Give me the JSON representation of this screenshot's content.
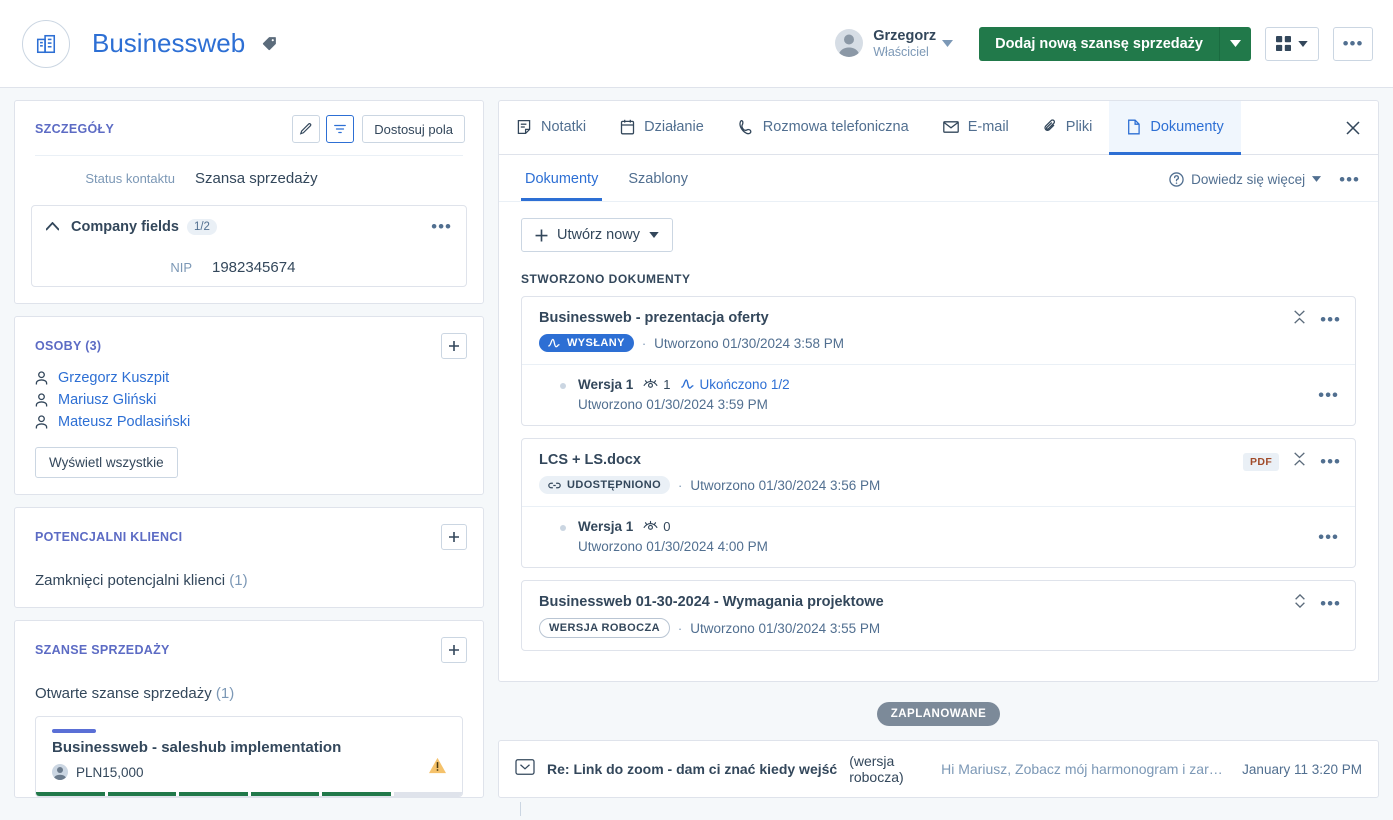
{
  "header": {
    "company_name": "Businessweb",
    "company_icon": "office-building-icon",
    "tag_icon": "tag-icon",
    "owner_name": "Grzegorz",
    "owner_role": "Właściciel",
    "primary_button": "Dodaj nową szansę sprzedaży",
    "grid_icon": "grid-view-icon",
    "more_icon": "ellipsis-icon",
    "accent_green": "#21794a",
    "accent_blue": "#2d6fd4"
  },
  "details": {
    "title": "SZCZEGÓŁY",
    "edit_icon": "pencil-icon",
    "filter_icon": "filter-icon",
    "customize_button": "Dostosuj pola",
    "field_label": "Status kontaktu",
    "field_value": "Szansa sprzedaży",
    "group": {
      "title": "Company fields",
      "count": "1/2",
      "collapse_icon": "chevron-up-icon",
      "more_icon": "ellipsis-icon",
      "fields": [
        {
          "label": "NIP",
          "value": "1982345674"
        }
      ]
    }
  },
  "people": {
    "title": "OSOBY (3)",
    "add_icon": "plus-icon",
    "items": [
      {
        "name": "Grzegorz Kuszpit",
        "icon": "person-icon"
      },
      {
        "name": "Mariusz Gliński",
        "icon": "person-icon"
      },
      {
        "name": "Mateusz Podlasiński",
        "icon": "person-icon"
      }
    ],
    "view_all_button": "Wyświetl wszystkie"
  },
  "leads": {
    "title": "POTENCJALNI KLIENCI",
    "add_icon": "plus-icon",
    "row_text": "Zamknięci potencjalni klienci",
    "row_count": "(1)"
  },
  "deals": {
    "title": "SZANSE SPRZEDAŻY",
    "add_icon": "plus-icon",
    "open_text": "Otwarte szanse sprzedaży",
    "open_count": "(1)",
    "card": {
      "title": "Businessweb - saleshub implementation",
      "amount": "PLN15,000",
      "warning_icon": "warning-triangle-icon",
      "avatar_icon": "person-avatar-icon",
      "stages_total": 6,
      "stages_complete": 5
    }
  },
  "tabs": {
    "items": [
      {
        "label": "Notatki",
        "icon": "note-icon",
        "active": false
      },
      {
        "label": "Działanie",
        "icon": "calendar-icon",
        "active": false
      },
      {
        "label": "Rozmowa telefoniczna",
        "icon": "phone-icon",
        "active": false
      },
      {
        "label": "E-mail",
        "icon": "envelope-icon",
        "active": false
      },
      {
        "label": "Pliki",
        "icon": "paperclip-icon",
        "active": false
      },
      {
        "label": "Dokumenty",
        "icon": "document-icon",
        "active": true
      }
    ],
    "close_icon": "close-icon"
  },
  "documents_panel": {
    "subtabs": [
      {
        "label": "Dokumenty",
        "active": true
      },
      {
        "label": "Szablony",
        "active": false
      }
    ],
    "learn_more": "Dowiedz się więcej",
    "help_icon": "question-circle-icon",
    "chevron_icon": "chevron-down-icon",
    "more_icon": "ellipsis-icon",
    "create_button": "Utwórz nowy",
    "create_icon": "plus-icon",
    "create_chevron": "chevron-down-icon",
    "section_label": "STWORZONO DOKUMENTY",
    "created_prefix": "Utworzono",
    "documents": [
      {
        "title": "Businessweb - prezentacja oferty",
        "status_badge": "WYSŁANY",
        "status_type": "sent",
        "status_icon": "signature-icon",
        "created": "Utworzono 01/30/2024 3:58 PM",
        "file_badge": null,
        "collapse_icon": "collapse-icon",
        "more_icon": "ellipsis-icon",
        "version": {
          "name": "Wersja 1",
          "views_icon": "eye-icon",
          "views": "1",
          "signed_icon": "signature-icon",
          "signed_text": "Ukończono 1/2",
          "created": "Utworzono 01/30/2024 3:59 PM",
          "more_icon": "ellipsis-icon"
        }
      },
      {
        "title": "LCS + LS.docx",
        "status_badge": "UDOSTĘPNIONO",
        "status_type": "shared",
        "status_icon": "link-icon",
        "created": "Utworzono 01/30/2024 3:56 PM",
        "file_badge": "PDF",
        "collapse_icon": "collapse-icon",
        "more_icon": "ellipsis-icon",
        "version": {
          "name": "Wersja 1",
          "views_icon": "eye-icon",
          "views": "0",
          "signed_icon": null,
          "signed_text": null,
          "created": "Utworzono 01/30/2024 4:00 PM",
          "more_icon": "ellipsis-icon"
        }
      },
      {
        "title": "Businessweb 01-30-2024 - Wymagania projektowe",
        "status_badge": "WERSJA ROBOCZA",
        "status_type": "draft",
        "status_icon": null,
        "created": "Utworzono 01/30/2024 3:55 PM",
        "file_badge": null,
        "collapse_icon": "expand-icon",
        "more_icon": "ellipsis-icon",
        "version": null
      }
    ]
  },
  "timeline": {
    "scheduled_badge": "ZAPLANOWANE",
    "email": {
      "icon": "email-collapsed-icon",
      "subject": "Re: Link do zoom - dam ci znać kiedy wejść",
      "draft_marker": "(wersja robocza)",
      "preview": "Hi Mariusz, Zobacz mój harmonogram i zarezerwuj termin ...",
      "date": "January 11 3:20 PM"
    }
  }
}
